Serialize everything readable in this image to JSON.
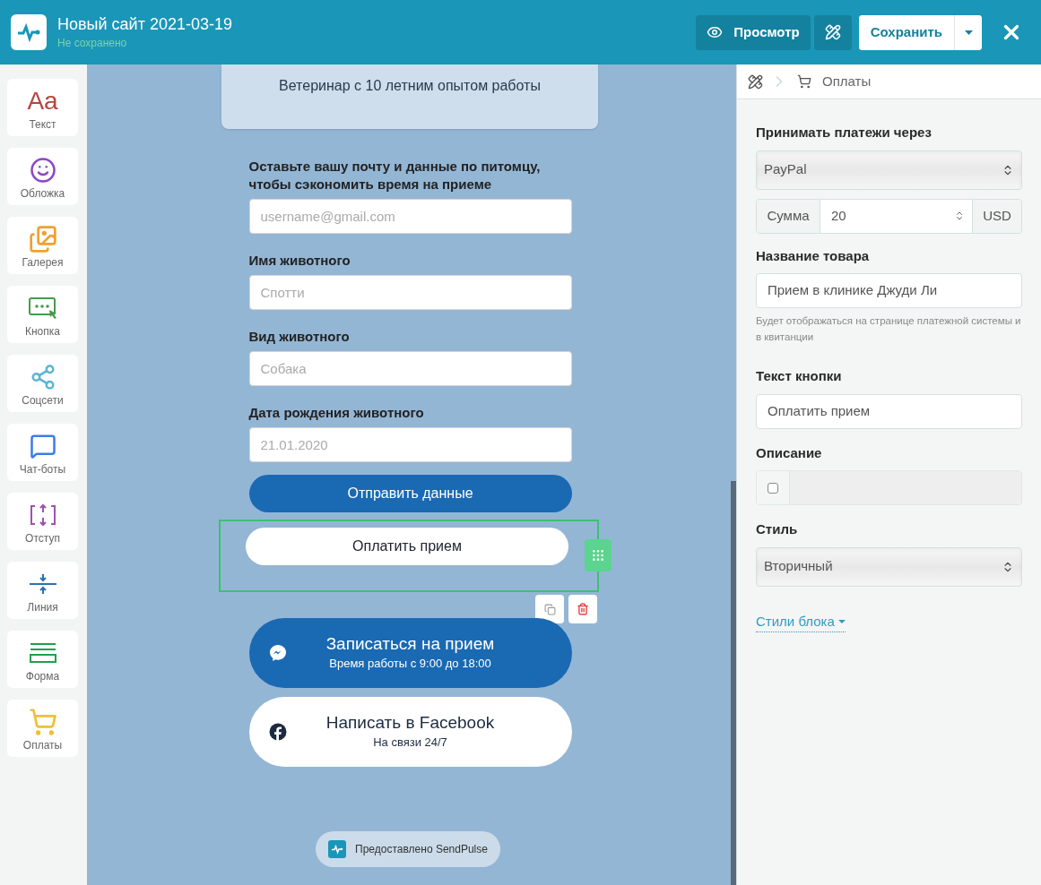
{
  "header": {
    "title": "Новый сайт 2021-03-19",
    "status": "Не сохранено",
    "preview_button": "Просмотр",
    "save_button": "Сохранить"
  },
  "sidebar": {
    "items": [
      {
        "kind": "text",
        "glyph": "Aa",
        "label": "Текст"
      },
      {
        "kind": "cover",
        "label": "Обложка"
      },
      {
        "kind": "gallery",
        "label": "Галерея"
      },
      {
        "kind": "button",
        "label": "Кнопка"
      },
      {
        "kind": "social",
        "label": "Соцсети"
      },
      {
        "kind": "chatbot",
        "label": "Чат-боты"
      },
      {
        "kind": "spacing",
        "label": "Отступ"
      },
      {
        "kind": "line",
        "label": "Линия"
      },
      {
        "kind": "form",
        "label": "Форма"
      },
      {
        "kind": "payment",
        "label": "Оплаты"
      }
    ]
  },
  "canvas": {
    "card_text": "Ветеринар с 10 летним опытом работы",
    "form_intro": "Оставьте вашу почту и данные по питомцу, чтобы сэкономить время на приеме",
    "fields": [
      {
        "placeholder": "username@gmail.com"
      },
      {
        "label": "Имя животного",
        "placeholder": "Спотти"
      },
      {
        "label": "Вид животного",
        "placeholder": "Собака"
      },
      {
        "label": "Дата рождения животного",
        "placeholder": "21.01.2020"
      }
    ],
    "submit_button": "Отправить данные",
    "pay_block": {
      "button": "Оплатить прием",
      "selected": true
    },
    "social_buttons": [
      {
        "kind": "messenger",
        "title": "Записаться на прием",
        "subtitle": "Время работы с 9:00 до 18:00"
      },
      {
        "kind": "facebook",
        "title": "Написать в Facebook",
        "subtitle": "На связи 24/7"
      }
    ],
    "badge": "Предоставлено SendPulse"
  },
  "panel": {
    "breadcrumb": "Оплаты",
    "payment_label": "Принимать платежи через",
    "payment_value": "PayPal",
    "amount_label": "Сумма",
    "amount_value": "20",
    "currency": "USD",
    "product_label": "Название товара",
    "product_value": "Прием в клинике Джуди Ли",
    "product_hint": "Будет отображаться на странице платежной системы и в квитанции",
    "button_text_label": "Текст кнопки",
    "button_text_value": "Оплатить прием",
    "description_label": "Описание",
    "description_checked": false,
    "style_label": "Стиль",
    "style_value": "Вторичный",
    "block_styles_link": "Стили блока"
  }
}
